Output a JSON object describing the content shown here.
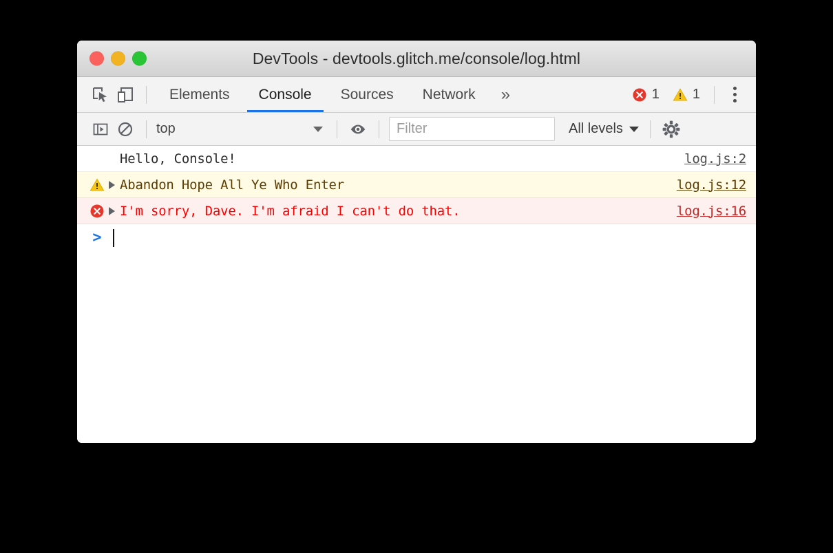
{
  "window": {
    "title": "DevTools - devtools.glitch.me/console/log.html",
    "traffic_lights": [
      {
        "name": "close",
        "color": "#fc625d"
      },
      {
        "name": "minimize",
        "color": "#f1b321"
      },
      {
        "name": "zoom",
        "color": "#2ac536"
      }
    ]
  },
  "tabbar": {
    "inspect_icon": "inspect-element-icon",
    "device_icon": "device-toolbar-icon",
    "tabs": [
      {
        "label": "Elements",
        "active": false
      },
      {
        "label": "Console",
        "active": true
      },
      {
        "label": "Sources",
        "active": false
      },
      {
        "label": "Network",
        "active": false
      }
    ],
    "more_label": "»",
    "error_count": "1",
    "warning_count": "1",
    "menu_icon": "more-vertical-icon",
    "active_tab_accent": "#1a73e8"
  },
  "filterbar": {
    "sidebar_toggle_icon": "console-sidebar-icon",
    "clear_icon": "clear-console-icon",
    "context_value": "top",
    "eye_icon": "live-expression-eye-icon",
    "filter_placeholder": "Filter",
    "filter_value": "",
    "levels_value": "All levels",
    "settings_icon": "settings-gear-icon"
  },
  "console": {
    "messages": [
      {
        "level": "log",
        "text": "Hello, Console!",
        "source": "log.js:2",
        "expandable": false,
        "icon": "",
        "bg": "#ffffff",
        "fg": "#2b2b2b"
      },
      {
        "level": "warning",
        "text": "Abandon Hope All Ye Who Enter",
        "source": "log.js:12",
        "expandable": true,
        "icon": "warning-triangle-icon",
        "bg": "#fffbe5",
        "fg": "#5c3c00"
      },
      {
        "level": "error",
        "text": "I'm sorry, Dave. I'm afraid I can't do that.",
        "source": "log.js:16",
        "expandable": true,
        "icon": "error-circle-icon",
        "bg": "#fff0f0",
        "fg": "#ff0000"
      }
    ],
    "prompt_symbol": ">",
    "prompt_value": ""
  }
}
